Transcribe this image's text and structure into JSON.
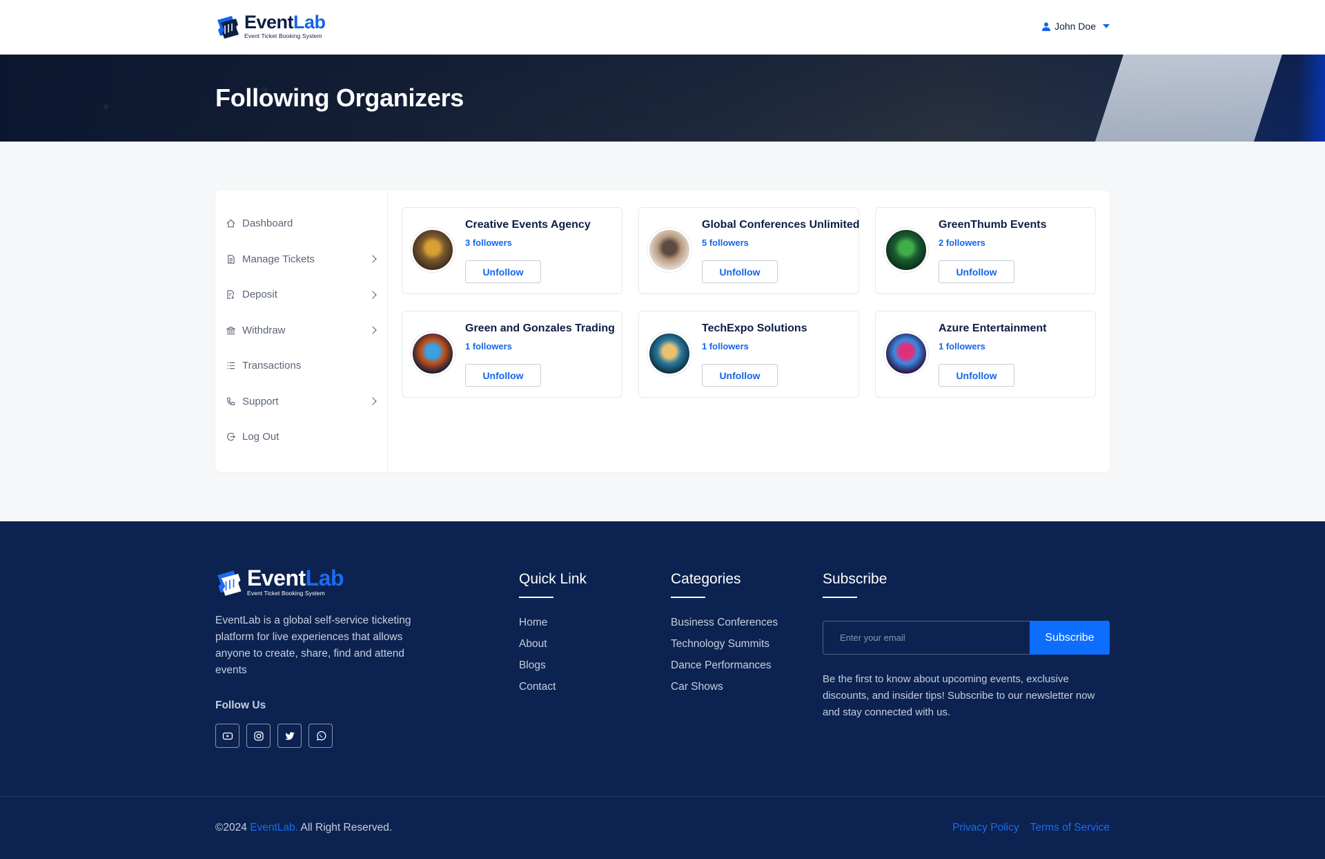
{
  "brand": {
    "name_part1": "Event",
    "name_part2": "Lab",
    "tagline": "Event Ticket Booking System"
  },
  "header": {
    "user_name": "John Doe",
    "user_icon": "user-icon"
  },
  "banner": {
    "title": "Following Organizers"
  },
  "sidebar": {
    "items": [
      {
        "label": "Dashboard",
        "icon": "home-icon",
        "has_submenu": false
      },
      {
        "label": "Manage Tickets",
        "icon": "ticket-icon",
        "has_submenu": true
      },
      {
        "label": "Deposit",
        "icon": "deposit-icon",
        "has_submenu": true
      },
      {
        "label": "Withdraw",
        "icon": "bank-icon",
        "has_submenu": true
      },
      {
        "label": "Transactions",
        "icon": "list-icon",
        "has_submenu": false
      },
      {
        "label": "Support",
        "icon": "phone-icon",
        "has_submenu": true
      },
      {
        "label": "Log Out",
        "icon": "logout-icon",
        "has_submenu": false
      }
    ]
  },
  "organizers": [
    {
      "name": "Creative Events Agency",
      "followers": "3 followers",
      "button": "Unfollow",
      "avatar_colors": [
        "#3b2a1a",
        "#d8a030",
        "#7a5a30"
      ]
    },
    {
      "name": "Global Conferences Unlimited",
      "followers": "5 followers",
      "button": "Unfollow",
      "avatar_colors": [
        "#e8e2da",
        "#5a4a42",
        "#b89a80"
      ]
    },
    {
      "name": "GreenThumb Events",
      "followers": "2 followers",
      "button": "Unfollow",
      "avatar_colors": [
        "#0d2a1a",
        "#3fae4a",
        "#1a5e30"
      ]
    },
    {
      "name": "Green and Gonzales Trading",
      "followers": "1 followers",
      "button": "Unfollow",
      "avatar_colors": [
        "#0a1a3a",
        "#3aa0e0",
        "#c0501a"
      ]
    },
    {
      "name": "TechExpo Solutions",
      "followers": "1 followers",
      "button": "Unfollow",
      "avatar_colors": [
        "#0a2a3a",
        "#e8c070",
        "#2a7aa0"
      ]
    },
    {
      "name": "Azure Entertainment",
      "followers": "1 followers",
      "button": "Unfollow",
      "avatar_colors": [
        "#2a0a3a",
        "#e0307a",
        "#3a8ae0"
      ]
    }
  ],
  "footer": {
    "description": "EventLab is a global self-service ticketing platform for live experiences that allows anyone to create, share, find and attend events",
    "follow_us": "Follow Us",
    "socials": [
      "youtube-icon",
      "instagram-icon",
      "twitter-icon",
      "whatsapp-icon"
    ],
    "quick_link": {
      "title": "Quick Link",
      "links": [
        "Home",
        "About",
        "Blogs",
        "Contact"
      ]
    },
    "categories": {
      "title": "Categories",
      "links": [
        "Business Conferences",
        "Technology Summits",
        "Dance Performances",
        "Car Shows"
      ]
    },
    "subscribe": {
      "title": "Subscribe",
      "placeholder": "Enter your email",
      "button": "Subscribe",
      "text": "Be the first to know about upcoming events, exclusive discounts, and insider tips! Subscribe to our newsletter now and stay connected with us."
    },
    "copyright_prefix": "©2024 ",
    "copyright_brand": "EventLab.",
    "copyright_suffix": " All Right Reserved.",
    "privacy": "Privacy Policy",
    "terms": "Terms of Service"
  },
  "colors": {
    "accent": "#1565e9",
    "navy": "#0c2250",
    "button_blue": "#0d6efd"
  }
}
